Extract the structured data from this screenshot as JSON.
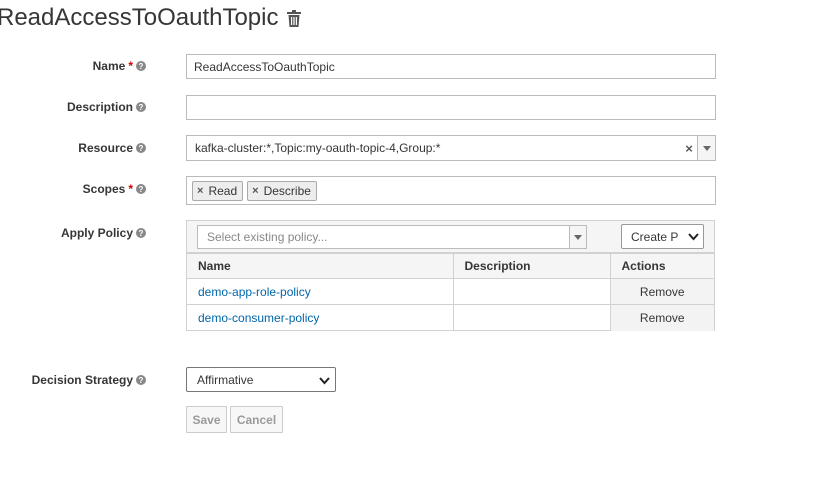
{
  "page": {
    "title": "ReadAccessToOauthTopic"
  },
  "form": {
    "name": {
      "label": "Name",
      "required_mark": "*",
      "value": "ReadAccessToOauthTopic"
    },
    "description": {
      "label": "Description",
      "value": ""
    },
    "resource": {
      "label": "Resource",
      "value": "kafka-cluster:*,Topic:my-oauth-topic-4,Group:*",
      "clear": "×"
    },
    "scopes": {
      "label": "Scopes",
      "required_mark": "*",
      "tags": [
        "Read",
        "Describe"
      ]
    },
    "apply_policy": {
      "label": "Apply Policy",
      "select_placeholder": "Select existing policy...",
      "create_label": "Create P",
      "columns": [
        "Name",
        "Description",
        "Actions"
      ],
      "rows": [
        {
          "name": "demo-app-role-policy",
          "description": "",
          "action": "Remove"
        },
        {
          "name": "demo-consumer-policy",
          "description": "",
          "action": "Remove"
        }
      ]
    },
    "decision_strategy": {
      "label": "Decision Strategy",
      "value": "Affirmative"
    }
  },
  "actions": {
    "save": "Save",
    "cancel": "Cancel"
  },
  "colors": {
    "link": "#0066aa",
    "required": "#cc0000",
    "text": "#363636"
  }
}
